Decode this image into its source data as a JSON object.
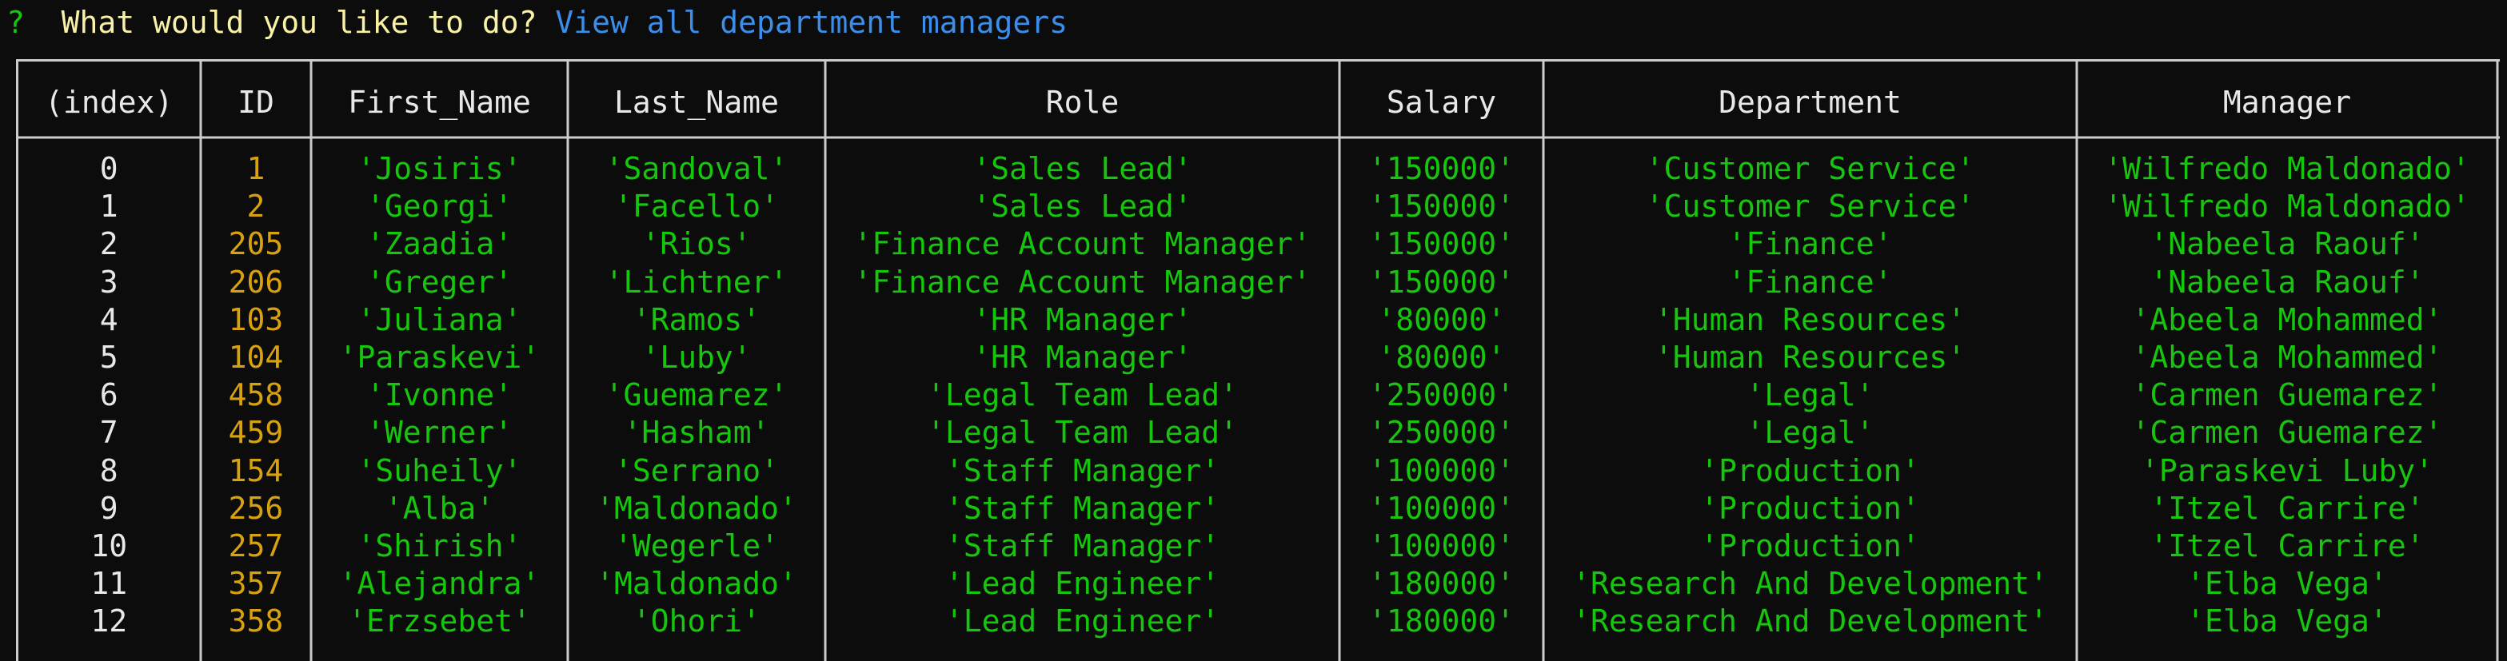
{
  "prompt": {
    "symbol": "?",
    "question": "What would you like to do?",
    "answer": "View all department managers"
  },
  "table": {
    "headers": [
      "(index)",
      "ID",
      "First_Name",
      "Last_Name",
      "Role",
      "Salary",
      "Department",
      "Manager"
    ],
    "rows": [
      [
        "0",
        "1",
        "'Josiris'",
        "'Sandoval'",
        "'Sales Lead'",
        "'150000'",
        "'Customer Service'",
        "'Wilfredo Maldonado'"
      ],
      [
        "1",
        "2",
        "'Georgi'",
        "'Facello'",
        "'Sales Lead'",
        "'150000'",
        "'Customer Service'",
        "'Wilfredo Maldonado'"
      ],
      [
        "2",
        "205",
        "'Zaadia'",
        "'Rios'",
        "'Finance Account Manager'",
        "'150000'",
        "'Finance'",
        "'Nabeela Raouf'"
      ],
      [
        "3",
        "206",
        "'Greger'",
        "'Lichtner'",
        "'Finance Account Manager'",
        "'150000'",
        "'Finance'",
        "'Nabeela Raouf'"
      ],
      [
        "4",
        "103",
        "'Juliana'",
        "'Ramos'",
        "'HR Manager'",
        "'80000'",
        "'Human Resources'",
        "'Abeela Mohammed'"
      ],
      [
        "5",
        "104",
        "'Paraskevi'",
        "'Luby'",
        "'HR Manager'",
        "'80000'",
        "'Human Resources'",
        "'Abeela Mohammed'"
      ],
      [
        "6",
        "458",
        "'Ivonne'",
        "'Guemarez'",
        "'Legal Team Lead'",
        "'250000'",
        "'Legal'",
        "'Carmen Guemarez'"
      ],
      [
        "7",
        "459",
        "'Werner'",
        "'Hasham'",
        "'Legal Team Lead'",
        "'250000'",
        "'Legal'",
        "'Carmen Guemarez'"
      ],
      [
        "8",
        "154",
        "'Suheily'",
        "'Serrano'",
        "'Staff Manager'",
        "'100000'",
        "'Production'",
        "'Paraskevi Luby'"
      ],
      [
        "9",
        "256",
        "'Alba'",
        "'Maldonado'",
        "'Staff Manager'",
        "'100000'",
        "'Production'",
        "'Itzel Carrire'"
      ],
      [
        "10",
        "257",
        "'Shirish'",
        "'Wegerle'",
        "'Staff Manager'",
        "'100000'",
        "'Production'",
        "'Itzel Carrire'"
      ],
      [
        "11",
        "357",
        "'Alejandra'",
        "'Maldonado'",
        "'Lead Engineer'",
        "'180000'",
        "'Research And Development'",
        "'Elba Vega'"
      ],
      [
        "12",
        "358",
        "'Erzsebet'",
        "'Ohori'",
        "'Lead Engineer'",
        "'180000'",
        "'Research And Development'",
        "'Elba Vega'"
      ]
    ]
  },
  "colors": {
    "background": "#0c0c0c",
    "prompt_symbol": "#16c60c",
    "question_text": "#f9f1a5",
    "answer_text": "#3b8eea",
    "number_values": "#d8a20e",
    "string_values": "#16c60c",
    "header_text": "#e8e8e8",
    "border": "#cccccc"
  }
}
